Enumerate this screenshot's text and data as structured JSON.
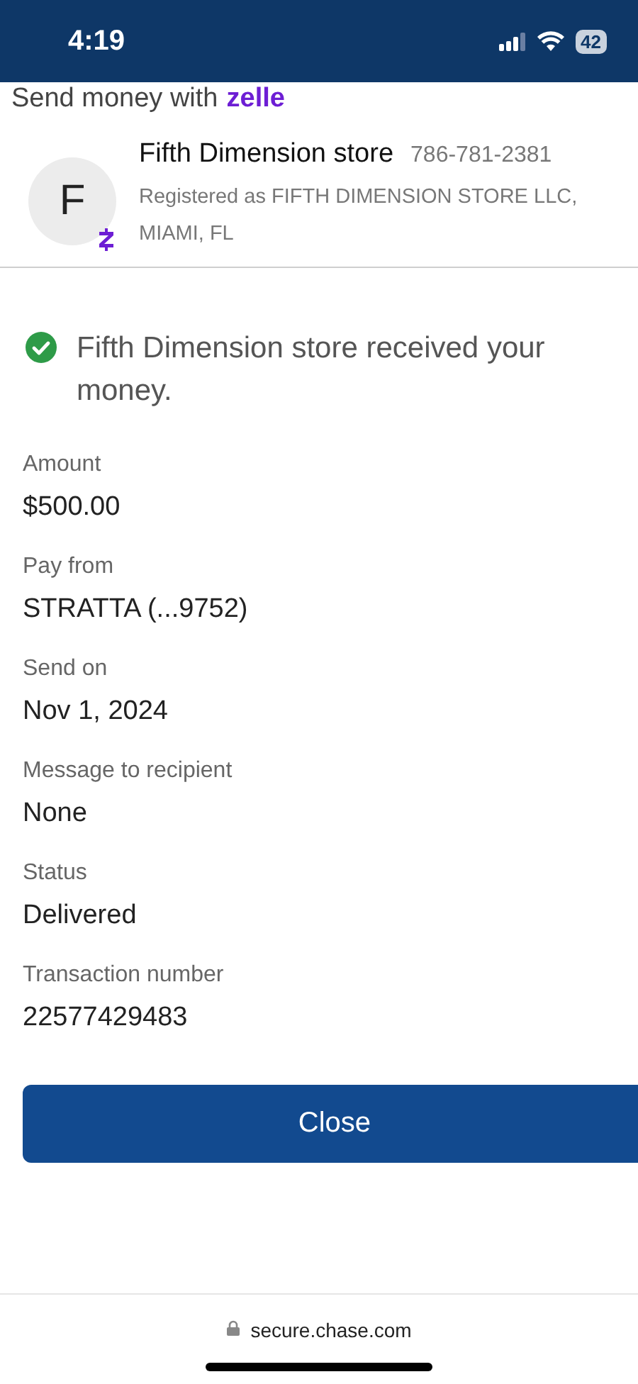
{
  "status_bar": {
    "time": "4:19",
    "battery": "42"
  },
  "header": {
    "title": "Send money with",
    "logo": "zelle"
  },
  "recipient": {
    "initial": "F",
    "name": "Fifth Dimension store",
    "phone": "786-781-2381",
    "registered": "Registered as FIFTH DIMENSION STORE LLC, MIAMI, FL"
  },
  "confirmation": "Fifth Dimension store received your money.",
  "details": [
    {
      "label": "Amount",
      "value": "$500.00"
    },
    {
      "label": "Pay from",
      "value": "STRATTA (...9752)"
    },
    {
      "label": "Send on",
      "value": "Nov 1, 2024"
    },
    {
      "label": "Message to recipient",
      "value": "None"
    },
    {
      "label": "Status",
      "value": "Delivered"
    },
    {
      "label": "Transaction number",
      "value": "22577429483"
    }
  ],
  "close_button": "Close",
  "address_bar": {
    "url": "secure.chase.com"
  }
}
